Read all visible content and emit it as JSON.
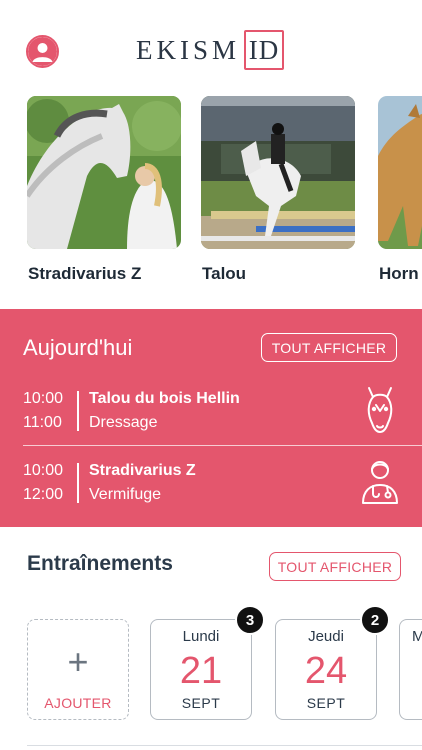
{
  "header": {
    "logo_text": "EKISM",
    "logo_id": "ID"
  },
  "horses": [
    {
      "name": "Stradivarius Z"
    },
    {
      "name": "Talou"
    },
    {
      "name": "Horn"
    }
  ],
  "today": {
    "title": "Aujourd'hui",
    "show_all": "TOUT AFFICHER",
    "events": [
      {
        "start": "10:00",
        "end": "11:00",
        "title": "Talou du bois Hellin",
        "subtitle": "Dressage",
        "icon": "horse-head-icon"
      },
      {
        "start": "10:00",
        "end": "12:00",
        "title": "Stradivarius Z",
        "subtitle": "Vermifuge",
        "icon": "veterinarian-icon"
      }
    ]
  },
  "trainings": {
    "title": "Entraînements",
    "show_all": "TOUT AFFICHER",
    "add_label": "AJOUTER",
    "add_symbol": "+",
    "days": [
      {
        "day": "Lundi",
        "date": "21",
        "month": "SEPT",
        "count": "3"
      },
      {
        "day": "Jeudi",
        "date": "24",
        "month": "SEPT",
        "count": "2"
      },
      {
        "day": "M",
        "date": "",
        "month": "",
        "count": ""
      }
    ]
  },
  "colors": {
    "accent": "#e4566d",
    "text_dark": "#2b3a4a"
  }
}
